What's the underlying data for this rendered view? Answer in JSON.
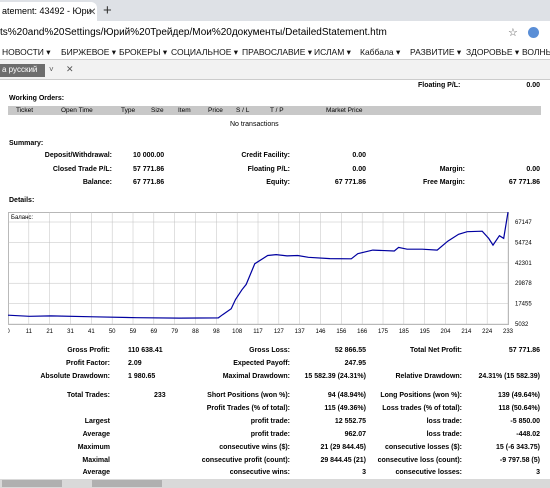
{
  "browser": {
    "tab_title": "atement: 43492 - Юри",
    "url": "ts%20and%20Settings/Юрий%20Трейдер/Мои%20документы/DetailedStatement.htm",
    "bookmarks": [
      "НОВОСТИ ▾",
      "БИРЖЕВОЕ ▾",
      "БРОКЕРЫ ▾",
      "СОЦИАЛЬНОЕ ▾",
      "ПРАВОСЛАВИЕ ▾",
      "ИСЛАМ ▾",
      "Каббала ▾",
      "РАЗВИТИЕ ▾",
      "ЗДОРОВЬЕ ▾",
      "ВОЛНЫ"
    ],
    "translate_lang": "а русский"
  },
  "top": {
    "floating_label": "Floating P/L:",
    "floating_value": "0.00"
  },
  "working_orders": {
    "title": "Working Orders:",
    "headers": [
      "Ticket",
      "Open Time",
      "Type",
      "Size",
      "Item",
      "Price",
      "S / L",
      "T / P",
      "Market Price"
    ],
    "empty": "No transactions"
  },
  "summary": {
    "title": "Summary:",
    "deposit_label": "Deposit/Withdrawal:",
    "deposit_value": "10 000.00",
    "credit_label": "Credit Facility:",
    "credit_value": "0.00",
    "closed_label": "Closed Trade P/L:",
    "closed_value": "57 771.86",
    "floating_label": "Floating P/L:",
    "floating_value": "0.00",
    "margin_label": "Margin:",
    "margin_value": "0.00",
    "balance_label": "Balance:",
    "balance_value": "67 771.86",
    "equity_label": "Equity:",
    "equity_value": "67 771.86",
    "free_label": "Free Margin:",
    "free_value": "67 771.86"
  },
  "details": {
    "title": "Details:"
  },
  "chart_data": {
    "type": "line",
    "title": "Баланс",
    "x_ticks": [
      "0",
      "11",
      "21",
      "31",
      "41",
      "50",
      "59",
      "69",
      "79",
      "88",
      "98",
      "108",
      "117",
      "127",
      "137",
      "146",
      "156",
      "166",
      "175",
      "185",
      "195",
      "204",
      "214",
      "224",
      "233"
    ],
    "y_ticks": [
      "67147",
      "54724",
      "42301",
      "29878",
      "17455",
      "5032"
    ],
    "ylim": [
      5032,
      67147
    ],
    "xlim": [
      0,
      233
    ],
    "grid": true,
    "x": [
      0,
      10,
      20,
      40,
      60,
      80,
      98,
      100,
      104,
      106,
      109,
      111,
      115,
      119,
      121,
      125,
      130,
      135,
      140,
      150,
      160,
      163,
      170,
      180,
      182,
      186,
      193,
      200,
      205,
      210,
      214,
      221,
      224,
      226,
      229,
      231,
      233
    ],
    "values": [
      9900,
      9300,
      9500,
      9000,
      8500,
      8300,
      8400,
      10200,
      13500,
      18600,
      24000,
      27000,
      38500,
      41500,
      43000,
      43500,
      42800,
      43000,
      42000,
      41300,
      41200,
      44000,
      46000,
      45500,
      47500,
      46500,
      46500,
      46000,
      51000,
      54800,
      56200,
      56500,
      52500,
      48800,
      54000,
      52500,
      67100
    ]
  },
  "stats": {
    "gross_profit_label": "Gross Profit:",
    "gross_profit": "110 638.41",
    "gross_loss_label": "Gross Loss:",
    "gross_loss": "52 866.55",
    "net_profit_label": "Total Net Profit:",
    "net_profit": "57 771.86",
    "profit_factor_label": "Profit Factor:",
    "profit_factor": "2.09",
    "expected_payoff_label": "Expected Payoff:",
    "expected_payoff": "247.95",
    "abs_dd_label": "Absolute Drawdown:",
    "abs_dd": "1 980.65",
    "max_dd_label": "Maximal Drawdown:",
    "max_dd": "15 582.39 (24.31%)",
    "rel_dd_label": "Relative Drawdown:",
    "rel_dd": "24.31% (15 582.39)",
    "total_trades_label": "Total Trades:",
    "total_trades": "233",
    "short_label": "Short Positions (won %):",
    "short": "94 (48.94%)",
    "long_label": "Long Positions (won %):",
    "long": "139 (49.64%)",
    "profit_trades_label": "Profit Trades (% of total):",
    "profit_trades": "115 (49.36%)",
    "loss_trades_label": "Loss trades (% of total):",
    "loss_trades": "118 (50.64%)",
    "largest_label": "Largest",
    "largest_profit_label": "profit trade:",
    "largest_profit": "12 552.75",
    "largest_loss_label": "loss trade:",
    "largest_loss": "-5 850.00",
    "average_label": "Average",
    "average_profit_label": "profit trade:",
    "average_profit": "962.07",
    "average_loss_label": "loss trade:",
    "average_loss": "-448.02",
    "maximum_label": "Maximum",
    "max_cons_wins_label": "consecutive wins ($):",
    "max_cons_wins": "21 (29 844.45)",
    "max_cons_losses_label": "consecutive losses ($):",
    "max_cons_losses": "15 (-6 343.75)",
    "maximal_label": "Maximal",
    "maximal_cons_profit_label": "consecutive profit (count):",
    "maximal_cons_profit": "29 844.45 (21)",
    "maximal_cons_loss_label": "consecutive loss (count):",
    "maximal_cons_loss": "-9 797.58 (5)",
    "average2_label": "Average",
    "avg_cons_wins_label": "consecutive wins:",
    "avg_cons_wins": "3",
    "avg_cons_losses_label": "consecutive losses:",
    "avg_cons_losses": "3"
  },
  "colors": {
    "line": "#0000a0",
    "grid": "#c0c0c0",
    "header": "#c8c8c8"
  }
}
